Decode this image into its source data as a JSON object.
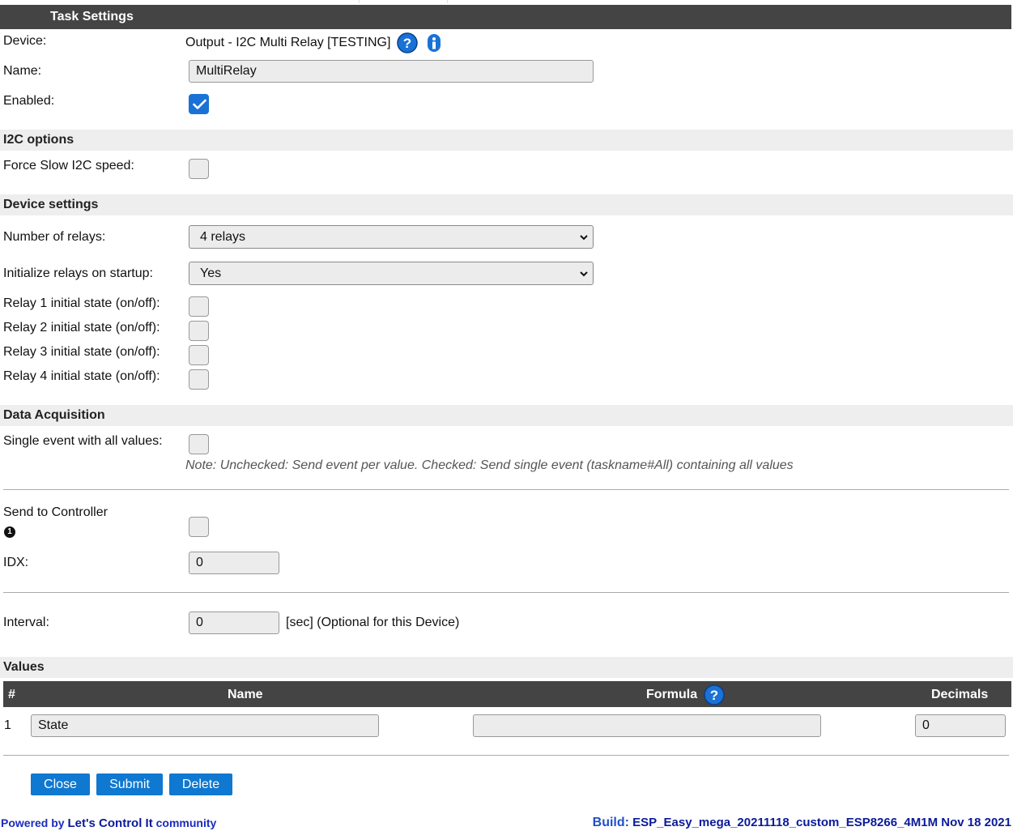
{
  "task_settings": {
    "title": "Task Settings",
    "device_label": "Device:",
    "device_value": "Output - I2C Multi Relay [TESTING]",
    "name_label": "Name:",
    "name_value": "MultiRelay",
    "enabled_label": "Enabled:",
    "enabled": true
  },
  "i2c_options": {
    "header": "I2C options",
    "force_slow_label": "Force Slow I2C speed:",
    "force_slow": false
  },
  "device_settings": {
    "header": "Device settings",
    "relays_label": "Number of relays:",
    "relays_value": "4 relays",
    "init_label": "Initialize relays on startup:",
    "init_value": "Yes",
    "relay_states": [
      {
        "label": "Relay 1 initial state (on/off):",
        "checked": false
      },
      {
        "label": "Relay 2 initial state (on/off):",
        "checked": false
      },
      {
        "label": "Relay 3 initial state (on/off):",
        "checked": false
      },
      {
        "label": "Relay 4 initial state (on/off):",
        "checked": false
      }
    ]
  },
  "data_acquisition": {
    "header": "Data Acquisition",
    "single_event_label": "Single event with all values:",
    "single_event": false,
    "note": "Note: Unchecked: Send event per value. Checked: Send single event (taskname#All) containing all values",
    "send_label": "Send to Controller",
    "send_badge": "1",
    "send": false,
    "idx_label": "IDX:",
    "idx_value": "0",
    "interval_label": "Interval:",
    "interval_value": "0",
    "interval_unit": "[sec] (Optional for this Device)"
  },
  "values": {
    "header": "Values",
    "columns": {
      "num": "#",
      "name": "Name",
      "formula": "Formula",
      "decimals": "Decimals"
    },
    "rows": [
      {
        "num": "1",
        "name": "State",
        "formula": "",
        "decimals": "0"
      }
    ]
  },
  "buttons": {
    "close": "Close",
    "submit": "Submit",
    "delete": "Delete"
  },
  "footer": {
    "powered_by": "Powered by",
    "community_name": "Let's Control It",
    "community": "community",
    "build_prefix": "Build:",
    "build_value": "ESP_Easy_mega_20211118_custom_ESP8266_4M1M Nov 18 2021"
  },
  "colors": {
    "accent": "#0f78d1",
    "header_bg": "#444444",
    "section_bg": "#eeeeee"
  },
  "icons": {
    "help": "question-circle-icon",
    "info": "info-icon",
    "check": "checkmark-icon",
    "dropdown": "chevron-down-icon"
  }
}
